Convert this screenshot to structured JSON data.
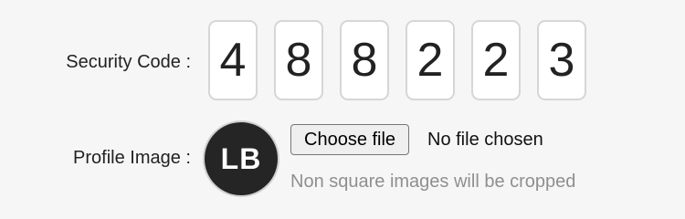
{
  "security_code": {
    "label": "Security Code :",
    "digits": [
      "4",
      "8",
      "8",
      "2",
      "2",
      "3"
    ]
  },
  "profile_image": {
    "label": "Profile Image :",
    "avatar_initials": "LB",
    "file_button_label": "Choose file",
    "file_status": "No file chosen",
    "hint": "Non square images will be cropped"
  },
  "colors": {
    "background": "#f6f6f6",
    "avatar_background": "#252525",
    "hint_text": "#8f8f8f"
  }
}
